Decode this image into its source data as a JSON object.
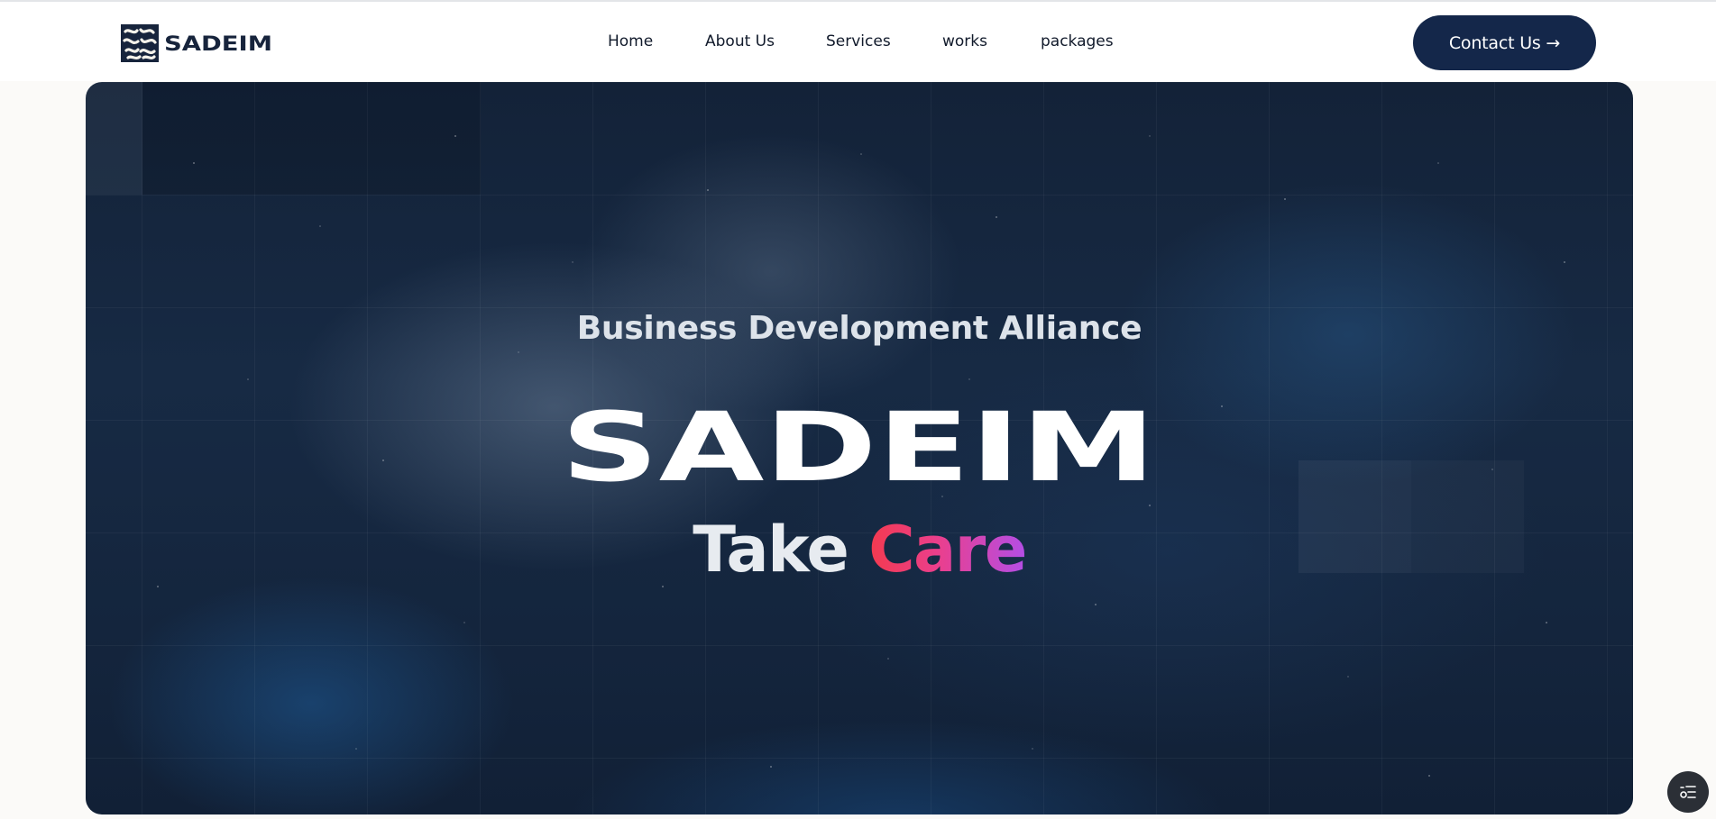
{
  "header": {
    "brand_name": "SADEIM",
    "nav": [
      {
        "label": "Home"
      },
      {
        "label": "About Us"
      },
      {
        "label": "Services"
      },
      {
        "label": "works"
      },
      {
        "label": "packages"
      }
    ],
    "contact_label": "Contact Us →"
  },
  "hero": {
    "subtitle": "Business Development Alliance",
    "brand_name": "SADEIM",
    "tagline_part1": "Take",
    "tagline_part2": "Care"
  },
  "colors": {
    "navy": "#14274a",
    "hero_background": "#152741",
    "care_gradient_start": "#f43a4e",
    "care_gradient_end": "#b34ee6"
  },
  "icons": {
    "logo_mark": "sadeim-logo-mark-icon",
    "floating_widget": "list-settings-icon"
  }
}
